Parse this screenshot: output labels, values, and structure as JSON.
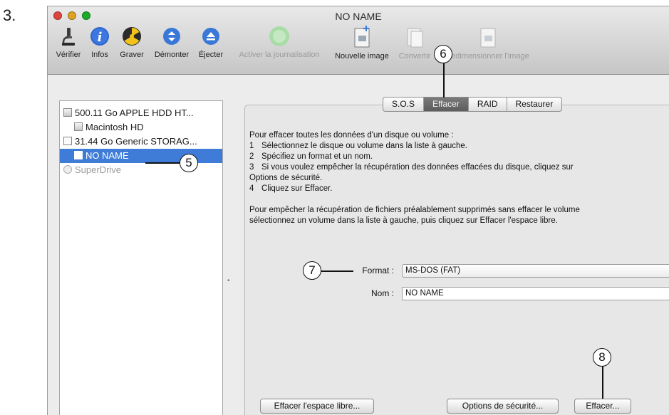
{
  "step": "3.",
  "window": {
    "title": "NO NAME",
    "traffic_colors": {
      "close": "#e0443e",
      "minimize": "#dea123",
      "zoom": "#1aab29"
    }
  },
  "toolbar": {
    "items": [
      {
        "label": "Vérifier",
        "icon": "microscope-icon",
        "enabled": true
      },
      {
        "label": "Infos",
        "icon": "info-icon",
        "enabled": true
      },
      {
        "label": "Graver",
        "icon": "burn-icon",
        "enabled": true
      },
      {
        "label": "Démonter",
        "icon": "unmount-icon",
        "enabled": true
      },
      {
        "label": "Éjecter",
        "icon": "eject-icon",
        "enabled": true
      },
      {
        "label": "Activer la journalisation",
        "icon": "journaling-icon",
        "enabled": false
      },
      {
        "label": "Nouvelle image",
        "icon": "new-image-icon",
        "enabled": true
      },
      {
        "label": "Convertir",
        "icon": "convert-icon",
        "enabled": false
      },
      {
        "label": "Redimensionner l'image",
        "icon": "resize-image-icon",
        "enabled": false
      }
    ]
  },
  "sidebar": {
    "items": [
      {
        "label": "500.11 Go APPLE HDD HT...",
        "icon": "hard-drive-icon",
        "indent": 0,
        "selected": false,
        "enabled": true
      },
      {
        "label": "Macintosh HD",
        "icon": "volume-icon",
        "indent": 1,
        "selected": false,
        "enabled": true
      },
      {
        "label": "31.44 Go Generic STORAG...",
        "icon": "external-drive-icon",
        "indent": 0,
        "selected": false,
        "enabled": true
      },
      {
        "label": "NO NAME",
        "icon": "volume-icon",
        "indent": 1,
        "selected": true,
        "enabled": true
      },
      {
        "label": "SuperDrive",
        "icon": "optical-drive-icon",
        "indent": 0,
        "selected": false,
        "enabled": false
      }
    ]
  },
  "tabs": [
    {
      "label": "S.O.S",
      "active": false
    },
    {
      "label": "Effacer",
      "active": true
    },
    {
      "label": "RAID",
      "active": false
    },
    {
      "label": "Restaurer",
      "active": false
    }
  ],
  "instructions": {
    "intro": "Pour effacer toutes les données d'un disque ou volume :",
    "steps": [
      {
        "num": "1",
        "text": "Sélectionnez le disque ou volume dans la liste à gauche."
      },
      {
        "num": "2",
        "text": "Spécifiez un format et un nom."
      },
      {
        "num": "3",
        "text": "Si vous voulez empêcher la récupération des données effacées du disque, cliquez sur"
      }
    ],
    "step3_cont": "Options de sécurité.",
    "step4": {
      "num": "4",
      "text": "Cliquez sur Effacer."
    },
    "free_space_line1": "Pour empêcher la récupération de fichiers préalablement supprimés sans effacer le volume",
    "free_space_line2": "sélectionnez un volume dans la liste à gauche, puis cliquez sur Effacer l'espace libre."
  },
  "form": {
    "format_label": "Format :",
    "format_value": "MS-DOS (FAT)",
    "name_label": "Nom :",
    "name_value": "NO NAME"
  },
  "buttons": {
    "erase_free_space": "Effacer l'espace libre...",
    "security_options": "Options de sécurité...",
    "erase": "Effacer..."
  },
  "callouts": [
    "5",
    "6",
    "7",
    "8"
  ]
}
